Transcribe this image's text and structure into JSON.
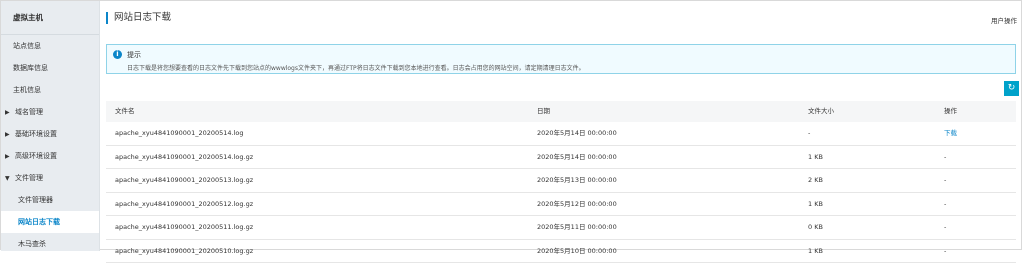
{
  "sidebar": {
    "title": "虚拟主机",
    "items": [
      {
        "label": "站点信息",
        "type": "plain"
      },
      {
        "label": "数据库信息",
        "type": "plain"
      },
      {
        "label": "主机信息",
        "type": "plain"
      },
      {
        "label": "域名管理",
        "type": "collapsed"
      },
      {
        "label": "基础环境设置",
        "type": "collapsed"
      },
      {
        "label": "高级环境设置",
        "type": "collapsed"
      },
      {
        "label": "文件管理",
        "type": "expanded"
      },
      {
        "label": "文件管理器",
        "type": "sub"
      },
      {
        "label": "网站日志下载",
        "type": "sub-active"
      },
      {
        "label": "木马查杀",
        "type": "sub"
      }
    ]
  },
  "header": {
    "title": "网站日志下载",
    "user_op": "用户操作"
  },
  "tip": {
    "title": "提示",
    "text": "日志下载是将您想要查看的日志文件先下载到您站点的wwwlogs文件夹下，再通过FTP将日志文件下载到您本地进行查看。日志会占用您的网站空间，请定期清理日志文件。"
  },
  "table": {
    "columns": [
      "文件名",
      "日期",
      "文件大小",
      "操作"
    ],
    "rows": [
      {
        "name": "apache_xyu4841090001_20200514.log",
        "date": "2020年5月14日 00:00:00",
        "size": "-",
        "action": "下载"
      },
      {
        "name": "apache_xyu4841090001_20200514.log.gz",
        "date": "2020年5月14日 00:00:00",
        "size": "1 KB",
        "action": "-"
      },
      {
        "name": "apache_xyu4841090001_20200513.log.gz",
        "date": "2020年5月13日 00:00:00",
        "size": "2 KB",
        "action": "-"
      },
      {
        "name": "apache_xyu4841090001_20200512.log.gz",
        "date": "2020年5月12日 00:00:00",
        "size": "1 KB",
        "action": "-"
      },
      {
        "name": "apache_xyu4841090001_20200511.log.gz",
        "date": "2020年5月11日 00:00:00",
        "size": "0 KB",
        "action": "-"
      },
      {
        "name": "apache_xyu4841090001_20200510.log.gz",
        "date": "2020年5月10日 00:00:00",
        "size": "1 KB",
        "action": "-"
      }
    ]
  },
  "icons": {
    "info": "info-icon",
    "refresh": "refresh-icon",
    "arrow_right": "caret-right-icon",
    "arrow_down": "caret-down-icon"
  },
  "colors": {
    "accent": "#0c86c9",
    "refresh_button": "#00a2ca",
    "tip_border": "#8fd3e8",
    "sidebar_bg": "#e8ecf0"
  }
}
